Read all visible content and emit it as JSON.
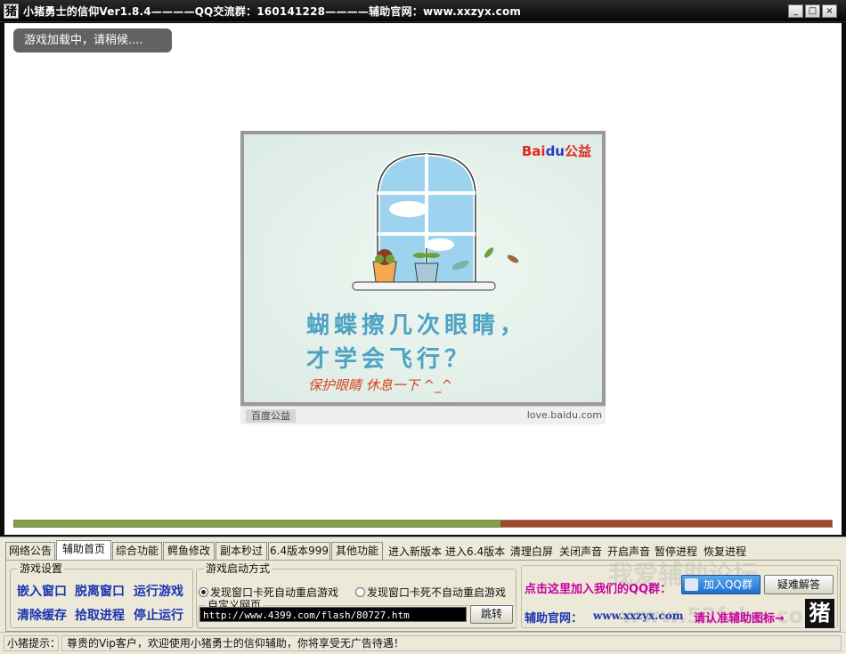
{
  "window": {
    "icon_char": "猪",
    "title": "小猪勇士的信仰Ver1.8.4————QQ交流群：160141228————辅助官网：www.xxzyx.com",
    "buttons": [
      "_",
      "□",
      "×"
    ]
  },
  "browser": {
    "loading_text": "游戏加载中，请稍候....",
    "ad": {
      "logo_text": "Bai",
      "logo_du": "du",
      "logo_suffix": "公益",
      "line1": "蝴蝶擦几次眼睛，",
      "line2": "才学会飞行？",
      "slogan": "保护眼睛  休息一下  ^_^",
      "footer_left": "百度公益",
      "footer_right": "love.baidu.com"
    }
  },
  "progress": {
    "value": 0.595
  },
  "tabs": [
    {
      "label": "网络公告"
    },
    {
      "label": "辅助首页",
      "active": true
    },
    {
      "label": "综合功能"
    },
    {
      "label": "鳄鱼修改"
    },
    {
      "label": "副本秒过"
    },
    {
      "label": "6.4版本999"
    },
    {
      "label": "其他功能"
    }
  ],
  "tab_links": [
    "进入新版本",
    "进入6.4版本",
    "清理白屏",
    "关闭声音",
    "开启声音",
    "暂停进程",
    "恢复进程"
  ],
  "game_settings": {
    "title": "游戏设置",
    "actions": [
      "嵌入窗口",
      "脱离窗口",
      "运行游戏",
      "清除缓存",
      "拾取进程",
      "停止运行"
    ]
  },
  "launch_mode": {
    "title": "游戏启动方式",
    "options": [
      "发现窗口卡死自动重启游戏",
      "发现窗口卡死不自动重启游戏"
    ],
    "selected": 0
  },
  "custom_page": {
    "title": "自定义网页",
    "url_value": "http://www.4399.com/flash/80727.htm",
    "go_label": "跳转"
  },
  "right_panel": {
    "join_text": "点击这里加入我们的QQ群：",
    "join_button": "加入QQ群",
    "faq_button": "疑难解答",
    "site_label": "辅助官网：",
    "site_url": "www.xxzyx.com",
    "recognize_text": "请认准辅助图标→",
    "logo_char": "猪",
    "watermark1": "我爱辅助论坛",
    "watermark2": "www.52fzba.com"
  },
  "statusbar": {
    "label": "小猪提示：",
    "message": "尊贵的Vip客户，欢迎使用小猪勇士的信仰辅助，你将享受无广告待遇！"
  },
  "colors": {
    "progress_fill": "#7da345",
    "progress_rest": "#a5452b",
    "action_text": "#1b35b0",
    "join_text": "#c800a0",
    "site_url": "#1b35b0"
  }
}
